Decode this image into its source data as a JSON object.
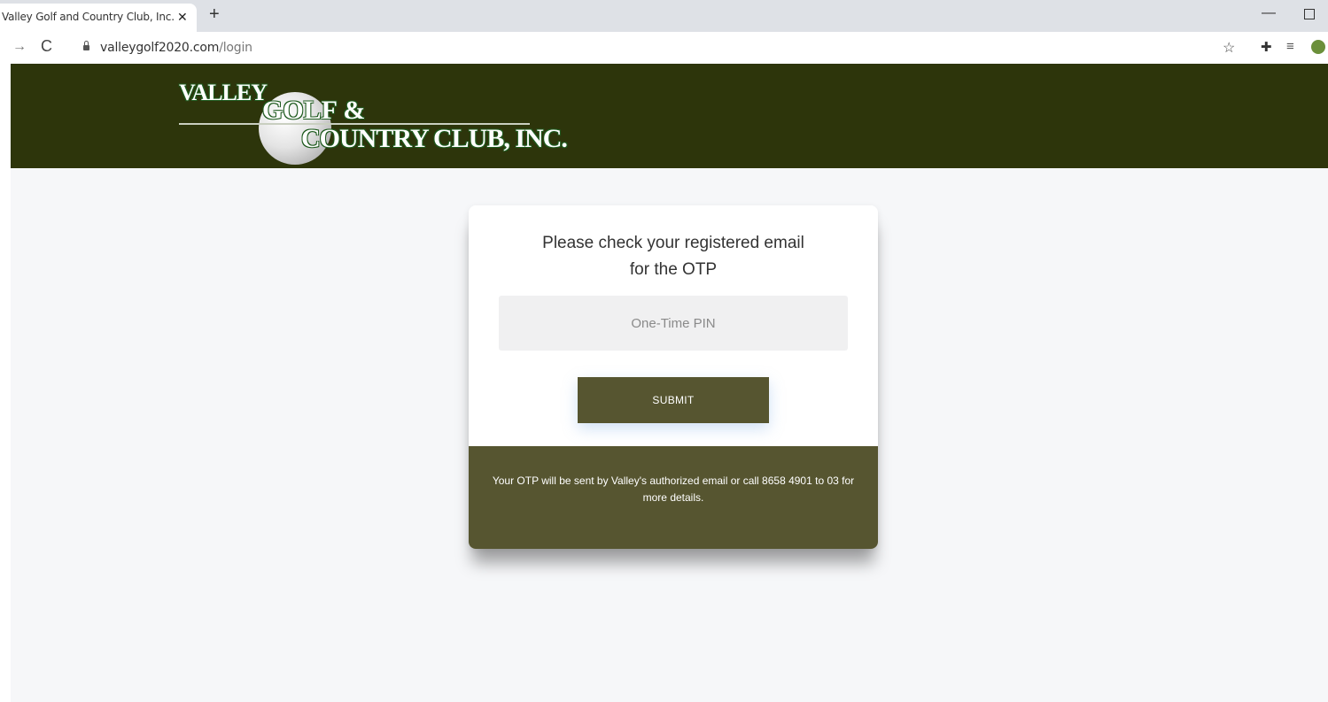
{
  "browser": {
    "tab_title": "Valley Golf and Country Club, Inc.",
    "tab_close": "✕",
    "new_tab": "+",
    "url_domain": "valleygolf2020.com",
    "url_path": "/login",
    "icons": {
      "forward": "→",
      "reload": "C",
      "lock": "lock-icon",
      "star": "☆",
      "extensions": "puzzle-icon",
      "queue": "queue-icon",
      "profile": "profile-icon"
    }
  },
  "header": {
    "logo_words": {
      "valley": "VALLEY",
      "golf": "GOLF &",
      "country_club": "COUNTRY CLUB, INC."
    },
    "background_color": "#2d350b"
  },
  "login": {
    "title_line1": "Please check your registered email",
    "title_line2": "for the OTP",
    "otp_placeholder": "One-Time PIN",
    "otp_value": "",
    "submit_label": "SUBMIT",
    "footer_text": "Your OTP will be sent by Valley's authorized email or call 8658 4901 to 03 for more details.",
    "accent_color": "#565530"
  }
}
